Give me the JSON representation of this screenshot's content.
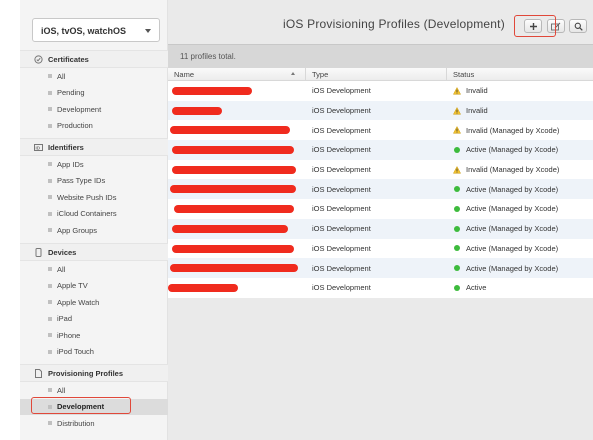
{
  "sidebar": {
    "platform": "iOS, tvOS, watchOS",
    "sections": [
      {
        "title": "Certificates",
        "icon": "certificate-icon",
        "items": [
          "All",
          "Pending",
          "Development",
          "Production"
        ]
      },
      {
        "title": "Identifiers",
        "icon": "id-icon",
        "items": [
          "App IDs",
          "Pass Type IDs",
          "Website Push IDs",
          "iCloud Containers",
          "App Groups"
        ]
      },
      {
        "title": "Devices",
        "icon": "device-icon",
        "items": [
          "All",
          "Apple TV",
          "Apple Watch",
          "iPad",
          "iPhone",
          "iPod Touch"
        ]
      },
      {
        "title": "Provisioning Profiles",
        "icon": "document-icon",
        "items": [
          "All",
          "Development",
          "Distribution"
        ]
      }
    ],
    "active_item": "Development"
  },
  "main": {
    "title": "iOS Provisioning Profiles (Development)",
    "toolbar": {
      "add": "+",
      "edit": "edit-icon",
      "search": "search-icon"
    },
    "count_text": "11 profiles total.",
    "columns": [
      "Name",
      "Type",
      "Status"
    ],
    "rows": [
      {
        "type": "iOS Development",
        "status": "Invalid",
        "state": "warning"
      },
      {
        "type": "iOS Development",
        "status": "Invalid",
        "state": "warning"
      },
      {
        "type": "iOS Development",
        "status": "Invalid (Managed by Xcode)",
        "state": "warning"
      },
      {
        "type": "iOS Development",
        "status": "Active (Managed by Xcode)",
        "state": "active"
      },
      {
        "type": "iOS Development",
        "status": "Invalid (Managed by Xcode)",
        "state": "warning"
      },
      {
        "type": "iOS Development",
        "status": "Active (Managed by Xcode)",
        "state": "active"
      },
      {
        "type": "iOS Development",
        "status": "Active (Managed by Xcode)",
        "state": "active"
      },
      {
        "type": "iOS Development",
        "status": "Active (Managed by Xcode)",
        "state": "active"
      },
      {
        "type": "iOS Development",
        "status": "Active (Managed by Xcode)",
        "state": "active"
      },
      {
        "type": "iOS Development",
        "status": "Active (Managed by Xcode)",
        "state": "active"
      },
      {
        "type": "iOS Development",
        "status": "Active",
        "state": "active"
      }
    ]
  },
  "colors": {
    "warning": "#f2c230",
    "active": "#3dbb3d",
    "redaction": "#f02b1e",
    "highlight": "#e0483a"
  }
}
